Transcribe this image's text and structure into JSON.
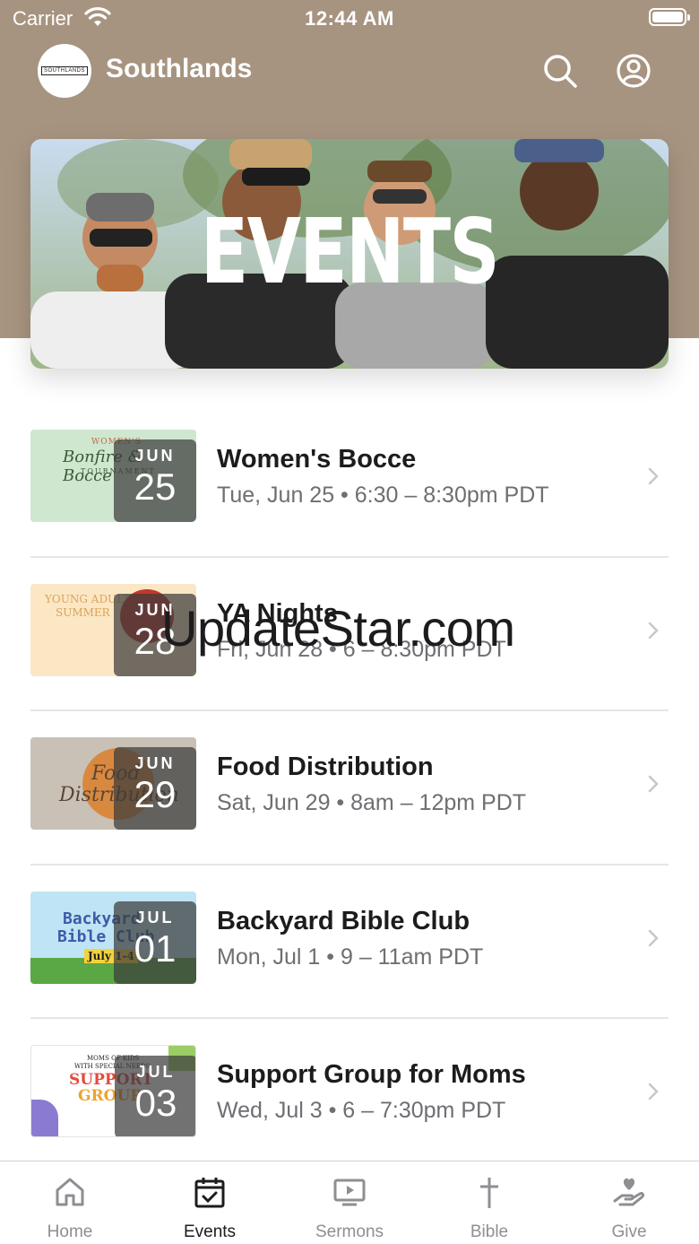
{
  "status_bar": {
    "carrier": "Carrier",
    "time": "12:44 AM"
  },
  "header": {
    "title": "Southlands",
    "logo_text": "SOUTHLANDS"
  },
  "icons": {
    "search": "search-icon",
    "account": "account-circle-icon",
    "chevron": "chevron-right-icon"
  },
  "hero": {
    "title": "EVENTS"
  },
  "thumb_text": {
    "womens_bocce": {
      "line1": "WOMEN'S",
      "line2": "Bonfire & Bocce",
      "line3": "TOURNAMENT"
    },
    "ya_nights": {
      "line1": "YOUNG ADULTS",
      "line2": "SUMMER"
    },
    "food_distribution": {
      "line1": "Food",
      "line2": "Distribution"
    },
    "backyard_bible_club": {
      "line1": "Backyard",
      "line2": "Bible Club",
      "line3": "July 1-4"
    },
    "support_group": {
      "line1": "MOMS OF KIDS",
      "line2": "WITH SPECIAL NEEDS",
      "line3": "SUPPORT",
      "line4": "GROUP"
    }
  },
  "events": [
    {
      "title": "Women's Bocce",
      "meta": "Tue, Jun 25 • 6:30 – 8:30pm PDT",
      "month": "JUN",
      "day": "25"
    },
    {
      "title": "YA Nights",
      "meta": "Fri, Jun 28 • 6 – 8:30pm PDT",
      "month": "JUN",
      "day": "28"
    },
    {
      "title": "Food Distribution",
      "meta": "Sat, Jun 29 • 8am – 12pm PDT",
      "month": "JUN",
      "day": "29"
    },
    {
      "title": "Backyard Bible Club",
      "meta": "Mon, Jul 1 • 9 – 11am PDT",
      "month": "JUL",
      "day": "01"
    },
    {
      "title": "Support Group for Moms",
      "meta": "Wed, Jul 3 • 6 – 7:30pm PDT",
      "month": "JUL",
      "day": "03"
    }
  ],
  "watermark": "UpdateStar.com",
  "tabs": [
    {
      "label": "Home",
      "icon": "home-icon"
    },
    {
      "label": "Events",
      "icon": "calendar-check-icon",
      "active": true
    },
    {
      "label": "Sermons",
      "icon": "tv-play-icon"
    },
    {
      "label": "Bible",
      "icon": "cross-icon"
    },
    {
      "label": "Give",
      "icon": "hand-heart-icon"
    }
  ],
  "colors": {
    "header_bg": "#a79480",
    "active_tab": "#1c1c1e",
    "inactive_tab": "#8e8e93",
    "meta_text": "#6e6e73"
  }
}
